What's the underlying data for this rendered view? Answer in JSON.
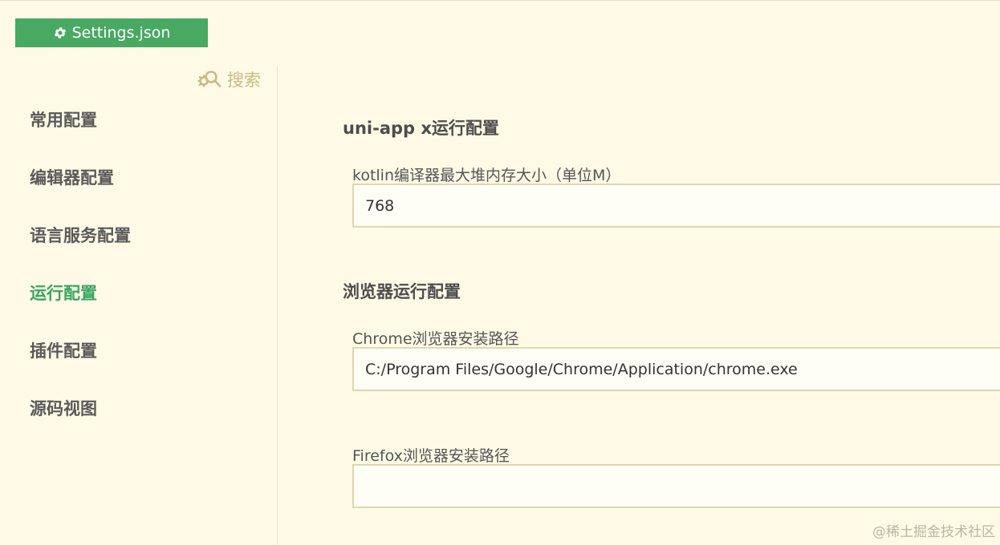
{
  "header": {
    "settings_button_label": "Settings.json",
    "settings_icon": "gear-icon"
  },
  "sidebar": {
    "search_label": "搜索",
    "search_icon": "gear-search-icon",
    "items": [
      {
        "label": "常用配置",
        "active": false
      },
      {
        "label": "编辑器配置",
        "active": false
      },
      {
        "label": "语言服务配置",
        "active": false
      },
      {
        "label": "运行配置",
        "active": true
      },
      {
        "label": "插件配置",
        "active": false
      },
      {
        "label": "源码视图",
        "active": false
      }
    ]
  },
  "main": {
    "sections": [
      {
        "title": "uni-app x运行配置",
        "fields": [
          {
            "label": "kotlin编译器最大堆内存大小（单位M）",
            "value": "768"
          }
        ]
      },
      {
        "title": "浏览器运行配置",
        "fields": [
          {
            "label": "Chrome浏览器安装路径",
            "value": "C:/Program Files/Google/Chrome/Application/chrome.exe"
          },
          {
            "label": "Firefox浏览器安装路径",
            "value": ""
          }
        ]
      }
    ]
  },
  "watermark": "@稀土掘金技术社区",
  "colors": {
    "accent": "#48a963",
    "active_nav": "#3aa562",
    "background": "#fefae6",
    "search": "#c9bb83"
  }
}
